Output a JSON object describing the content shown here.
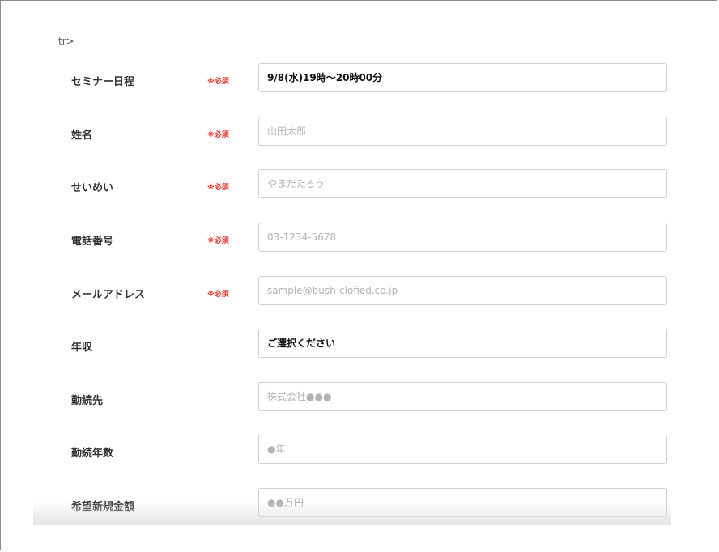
{
  "stray_text": "tr>",
  "required_label": "※必須",
  "rows": [
    {
      "label": "セミナー日程",
      "required": true,
      "type": "value",
      "value": "9/8(水)19時〜20時00分"
    },
    {
      "label": "姓名",
      "required": true,
      "type": "input",
      "placeholder": "山田太郎"
    },
    {
      "label": "せいめい",
      "required": true,
      "type": "input",
      "placeholder": "やまだたろう"
    },
    {
      "label": "電話番号",
      "required": true,
      "type": "input",
      "placeholder": "03-1234-5678"
    },
    {
      "label": "メールアドレス",
      "required": true,
      "type": "input",
      "placeholder": "sample@bush-clofied.co.jp"
    },
    {
      "label": "年収",
      "required": false,
      "type": "select",
      "value": "ご選択ください"
    },
    {
      "label": "勤続先",
      "required": false,
      "type": "input",
      "placeholder": "株式会社●●●"
    },
    {
      "label": "勤続年数",
      "required": false,
      "type": "input",
      "placeholder": "●年"
    },
    {
      "label": "希望新規金額",
      "required": false,
      "type": "input",
      "placeholder": "●●万円"
    }
  ],
  "colors": {
    "required": "#e0302a",
    "border": "#cfcfcf",
    "placeholder": "#b3b3b3"
  }
}
